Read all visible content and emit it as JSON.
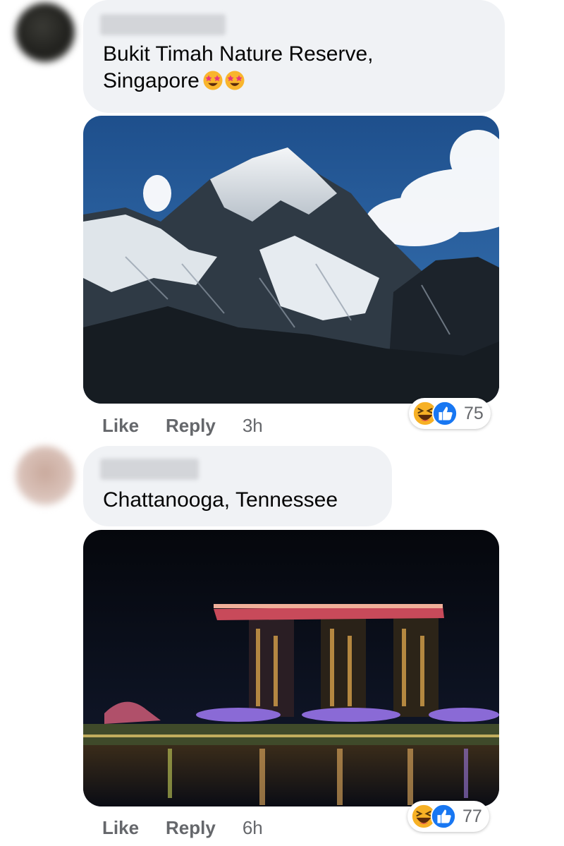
{
  "comments": [
    {
      "text_line1": "Bukit Timah Nature Reserve,",
      "text_line2": "Singapore",
      "emojis": [
        "star-struck-icon",
        "star-struck-icon"
      ],
      "photo": "snowy-mountain-peak",
      "actions": {
        "like": "Like",
        "reply": "Reply",
        "time": "3h"
      },
      "reactions": {
        "icons": [
          "haha-icon",
          "like-icon"
        ],
        "count": "75"
      }
    },
    {
      "text_line1": "Chattanooga, Tennessee",
      "photo": "city-skyline-at-night",
      "actions": {
        "like": "Like",
        "reply": "Reply",
        "time": "6h"
      },
      "reactions": {
        "icons": [
          "haha-icon",
          "like-icon"
        ],
        "count": "77"
      }
    }
  ],
  "colors": {
    "bubble": "#f0f2f5",
    "meta_text": "#65676b",
    "like_blue": "#1877f2",
    "haha_yellow": "#f7b125"
  }
}
